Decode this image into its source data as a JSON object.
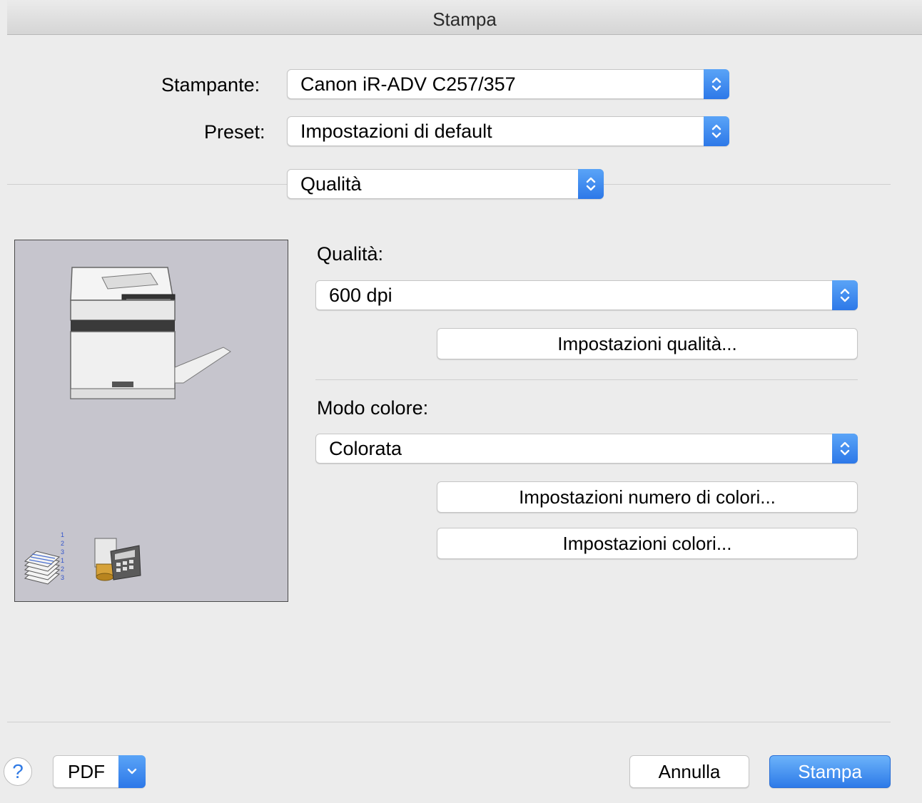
{
  "window": {
    "title": "Stampa"
  },
  "printer": {
    "label": "Stampante:",
    "value": "Canon iR-ADV C257/357"
  },
  "preset": {
    "label": "Preset:",
    "value": "Impostazioni di default"
  },
  "panel_menu": {
    "value": "Qualità"
  },
  "quality": {
    "label": "Qualità:",
    "value": "600 dpi",
    "settings_button": "Impostazioni qualità..."
  },
  "color_mode": {
    "label": "Modo colore:",
    "value": "Colorata",
    "number_button": "Impostazioni numero di colori...",
    "settings_button": "Impostazioni colori..."
  },
  "footer": {
    "help": "?",
    "pdf": "PDF",
    "cancel": "Annulla",
    "print": "Stampa"
  },
  "colors": {
    "accent": "#2d7ae8",
    "preview_bg": "#c6c5cd"
  },
  "icons": [
    "chevron-updown-icon",
    "chevron-down-icon",
    "printer-illustration",
    "collate-pages-icon",
    "accounting-icon",
    "help-icon"
  ]
}
